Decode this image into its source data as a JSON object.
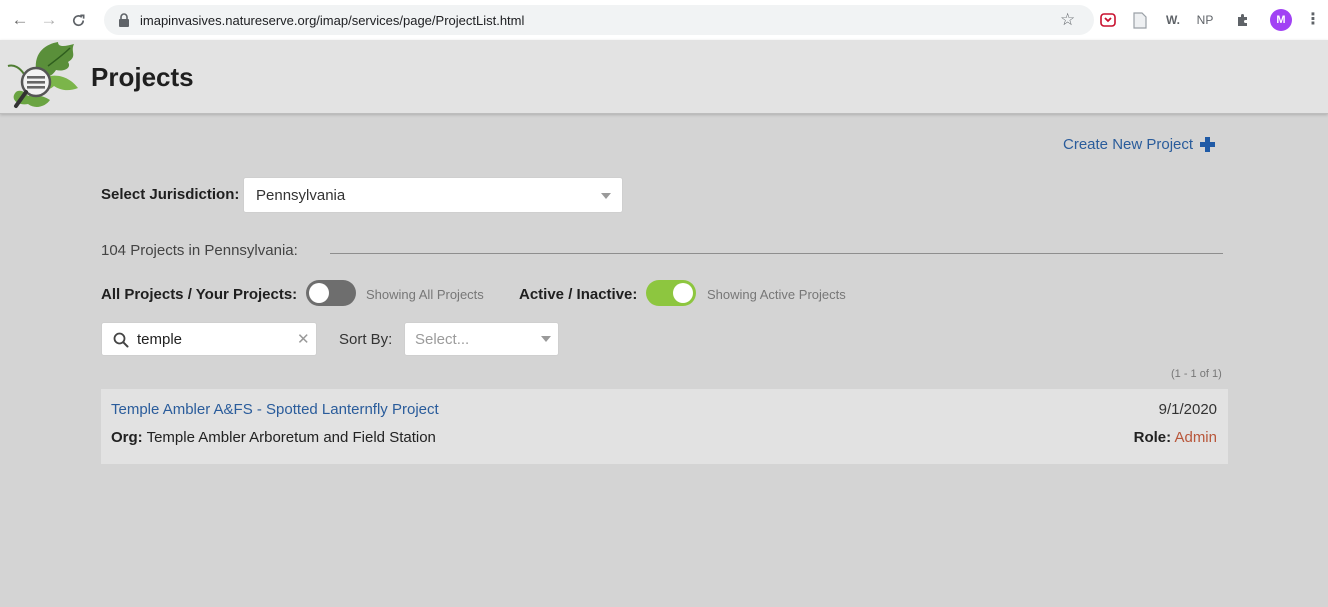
{
  "browser": {
    "url": "imapinvasives.natureserve.org/imap/services/page/ProjectList.html",
    "extensions": [
      "W.",
      "NP"
    ],
    "avatar_letter": "M"
  },
  "header": {
    "title": "Projects"
  },
  "toolbar": {
    "create_label": "Create New Project"
  },
  "jurisdiction": {
    "label": "Select Jurisdiction:",
    "selected": "Pennsylvania"
  },
  "summary": {
    "count_text": "104 Projects in Pennsylvania:"
  },
  "filters": {
    "projects_toggle": {
      "label": "All Projects / Your Projects:",
      "status": "Showing All Projects",
      "on": false
    },
    "active_toggle": {
      "label": "Active / Inactive:",
      "status": "Showing Active Projects",
      "on": true
    }
  },
  "search": {
    "value": "temple",
    "clear_glyph": "✕"
  },
  "sort": {
    "label": "Sort By:",
    "placeholder": "Select..."
  },
  "pager": {
    "text": "(1 - 1 of 1)"
  },
  "projects": [
    {
      "title": "Temple Ambler A&FS - Spotted Lanternfly Project",
      "date": "9/1/2020",
      "org_label": "Org:",
      "org": "Temple Ambler Arboretum and Field Station",
      "role_label": "Role:",
      "role": "Admin"
    }
  ],
  "colors": {
    "link": "#2a5c9b",
    "toggle_on": "#8dc63f",
    "toggle_off": "#6e6e6e",
    "role": "#b8563a",
    "background": "#d4d4d4"
  }
}
